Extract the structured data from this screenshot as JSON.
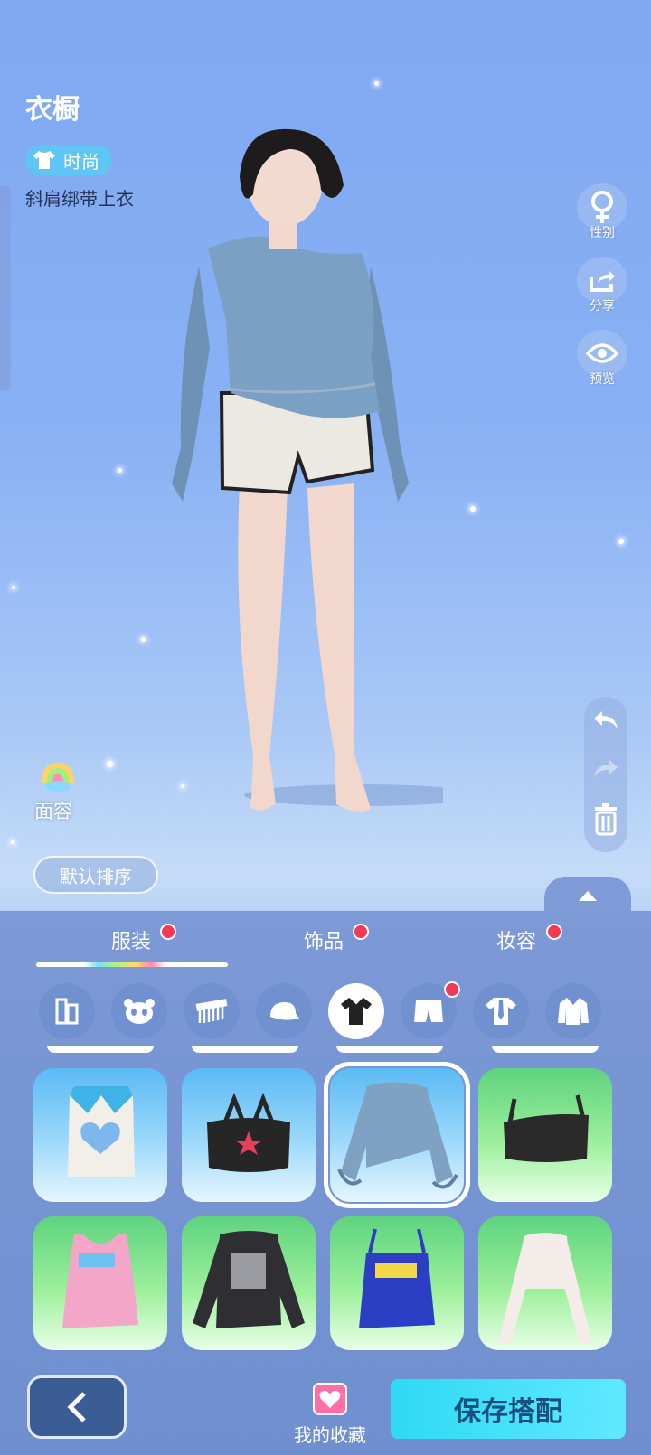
{
  "header": {
    "title": "衣橱",
    "tag_label": "时尚",
    "item_name": "斜肩绑带上衣"
  },
  "side_actions": [
    {
      "label": "性别",
      "icon": "gender-icon"
    },
    {
      "label": "分享",
      "icon": "share-icon"
    },
    {
      "label": "预览",
      "icon": "eye-icon"
    }
  ],
  "history": {
    "undo": "undo-icon",
    "redo": "redo-icon",
    "delete": "trash-icon"
  },
  "face": {
    "label": "面容"
  },
  "sort": {
    "label": "默认排序"
  },
  "tabs": [
    {
      "label": "服装",
      "badge": true,
      "active": true
    },
    {
      "label": "饰品",
      "badge": true
    },
    {
      "label": "妆容",
      "badge": true
    }
  ],
  "subcategories": [
    "suit",
    "panda",
    "comb",
    "cap",
    "shirt",
    "shorts",
    "tie-shirt",
    "jacket"
  ],
  "items": [
    "heart-crop-top",
    "star-bandeau",
    "off-shoulder-denim-top",
    "black-bra-top",
    "pink-graphic-tank",
    "black-print-longsleeve",
    "blue-graphic-cami",
    "white-turtleneck-crop"
  ],
  "footer": {
    "favorites_label": "我的收藏",
    "save_label": "保存搭配"
  },
  "colors": {
    "accent": "#2fd9f4",
    "badge": "#f23a54",
    "tag": "#5ec5f4"
  }
}
